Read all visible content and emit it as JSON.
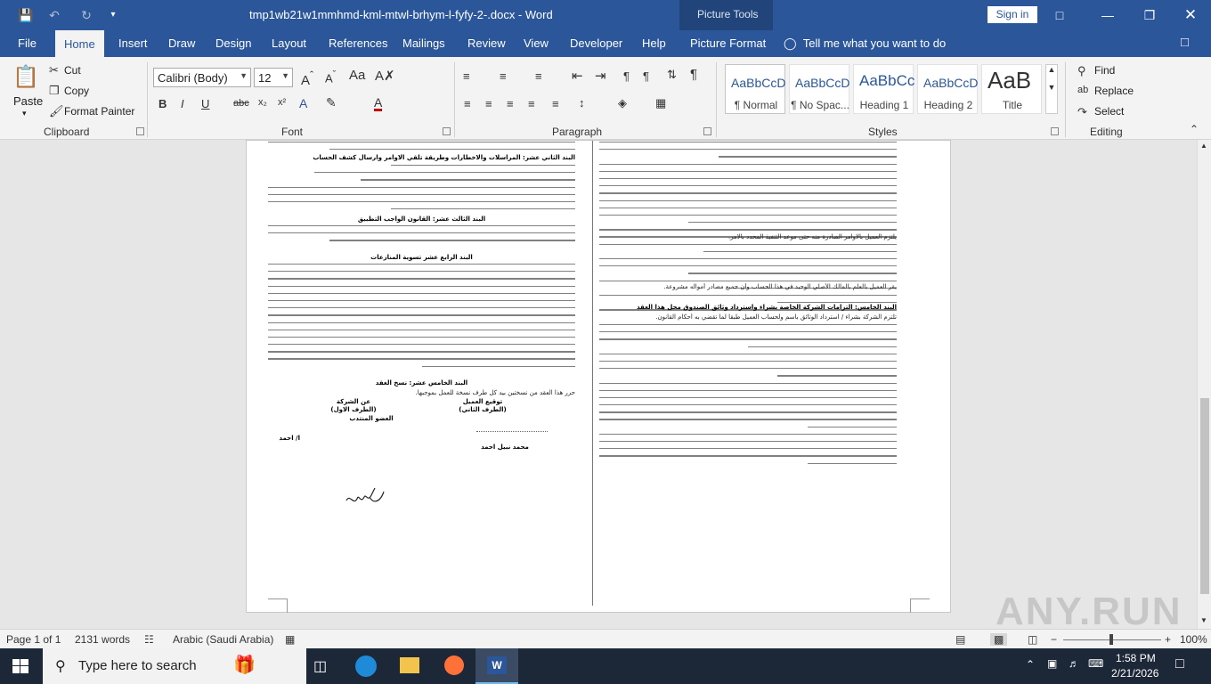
{
  "window": {
    "doc_title": "tmp1wb21w1mmhmd-kml-mtwl-brhym-l-fyfy-2-.docx - Word",
    "context_tab": "Picture Tools",
    "sign_in": "Sign in"
  },
  "tabs": [
    "File",
    "Home",
    "Insert",
    "Draw",
    "Design",
    "Layout",
    "References",
    "Mailings",
    "Review",
    "View",
    "Developer",
    "Help",
    "Picture Format"
  ],
  "tell_me": "Tell me what you want to do",
  "clipboard": {
    "paste": "Paste",
    "cut": "Cut",
    "copy": "Copy",
    "format_painter": "Format Painter",
    "label": "Clipboard"
  },
  "font": {
    "name": "Calibri (Body)",
    "size": "12",
    "label": "Font"
  },
  "paragraph": {
    "label": "Paragraph"
  },
  "styles": {
    "label": "Styles",
    "items": [
      {
        "preview": "AaBbCcD",
        "name": "¶ Normal"
      },
      {
        "preview": "AaBbCcD",
        "name": "¶ No Spac..."
      },
      {
        "preview": "AaBbCc",
        "name": "Heading 1"
      },
      {
        "preview": "AaBbCcD",
        "name": "Heading 2"
      },
      {
        "preview": "AaB",
        "name": "Title"
      }
    ]
  },
  "editing": {
    "find": "Find",
    "replace": "Replace",
    "select": "Select",
    "label": "Editing"
  },
  "document": {
    "left_col": [
      {
        "text": "البند الثاني عشر: المراسلات والاخطارات وطريقة تلقي الاوامر وارسال كشف الحساب",
        "bold": true
      },
      {
        "text": "البند الثالث عشر: القانون الواجب التطبيق",
        "bold": true
      },
      {
        "text": "البند الرابع عشر تسوية المنازعات",
        "bold": true
      },
      {
        "text": "البند الخامس عشر: نسخ العقد",
        "bold": true
      },
      {
        "text": "حرر هذا العقد من نسختين بيد كل طرف نسخة للعمل بموجبها.",
        "bold": false
      },
      {
        "text": "توقيع العميل",
        "bold": true
      },
      {
        "text": "(الطرف الثاني)",
        "bold": true
      },
      {
        "text": "عن الشركة",
        "bold": true
      },
      {
        "text": "(الطرف الاول)",
        "bold": true
      },
      {
        "text": "العضو المنتدب",
        "bold": true
      },
      {
        "text": "محمد نبيل احمد",
        "bold": true
      },
      {
        "text": "ا/ احمد",
        "bold": true
      }
    ],
    "right_col": [
      {
        "text": "البند الخامس: التزامات الشركة الخاصة بشراء واسترداد وثائق الصندوق محل هذا العقد",
        "bold": true
      },
      {
        "text": "تلتزم الشركة بشراء / استرداد الوثائق باسم ولحساب العميل طبقا لما تقضي به أحكام القانون.",
        "bold": false
      },
      {
        "text": "يلتزم العميل بالاوامر الصادرة منه حتى موعد التنفيذ المحدد بالامر.",
        "bold": false
      },
      {
        "text": "يقر العميل بالعلم بالمالك الأصلي الوحيد في هذا الحساب وأن جميع مصادر أمواله مشروعة.",
        "bold": false
      }
    ]
  },
  "status": {
    "page": "Page 1 of 1",
    "words": "2131 words",
    "language": "Arabic (Saudi Arabia)",
    "zoom": "100%"
  },
  "taskbar": {
    "search_placeholder": "Type here to search",
    "time": "1:58 PM",
    "date": "2/21/2026"
  },
  "watermark": "ANY.RUN"
}
